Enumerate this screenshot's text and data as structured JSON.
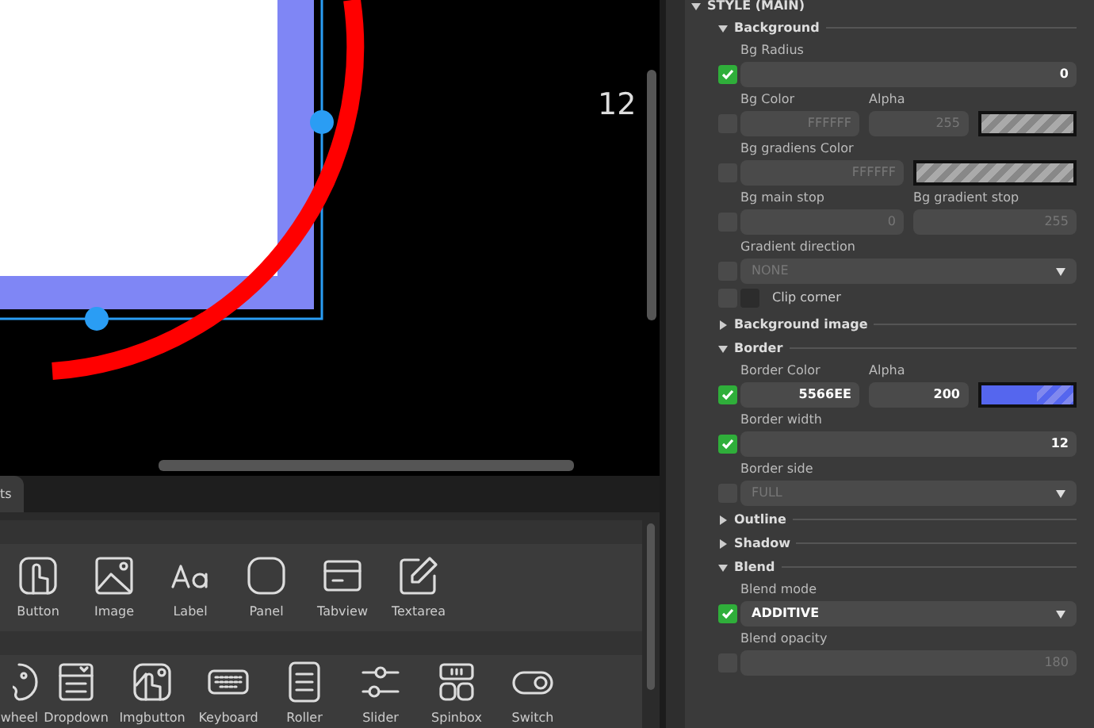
{
  "canvas": {
    "ruler_label": "12"
  },
  "widget_tabs": [
    {
      "label": "ts",
      "selected": true
    }
  ],
  "widget_rows": [
    {
      "items": [
        {
          "label": "Button",
          "kind": "button"
        },
        {
          "label": "Image",
          "kind": "image"
        },
        {
          "label": "Label",
          "kind": "label"
        },
        {
          "label": "Panel",
          "kind": "panel"
        },
        {
          "label": "Tabview",
          "kind": "tabview"
        },
        {
          "label": "Textarea",
          "kind": "textarea"
        }
      ]
    },
    {
      "items": [
        {
          "label": "wheel",
          "kind": "palette"
        },
        {
          "label": "Dropdown",
          "kind": "dropdown"
        },
        {
          "label": "Imgbutton",
          "kind": "imgbutton"
        },
        {
          "label": "Keyboard",
          "kind": "keyboard"
        },
        {
          "label": "Roller",
          "kind": "roller"
        },
        {
          "label": "Slider",
          "kind": "slider"
        },
        {
          "label": "Spinbox",
          "kind": "spinbox"
        },
        {
          "label": "Switch",
          "kind": "switch"
        }
      ]
    }
  ],
  "inspector": {
    "title": "STYLE (MAIN)",
    "expanded": true,
    "groups": [
      {
        "title": "Background",
        "expanded": true,
        "props": [
          {
            "checked": true,
            "fields": [
              {
                "kind": "number",
                "label": "Bg Radius",
                "value": "0"
              }
            ]
          },
          {
            "checked": false,
            "fields": [
              {
                "kind": "number",
                "label": "Bg Color",
                "value": "FFFFFF"
              },
              {
                "kind": "number",
                "label": "Alpha",
                "value": "255"
              },
              {
                "kind": "swatch"
              }
            ]
          },
          {
            "checked": false,
            "fields": [
              {
                "kind": "number",
                "label": "Bg gradiens Color",
                "value": "FFFFFF"
              },
              {
                "kind": "swatch"
              }
            ]
          },
          {
            "checked": false,
            "fields": [
              {
                "kind": "number",
                "label": "Bg main stop",
                "value": "0"
              },
              {
                "kind": "number",
                "label": "Bg gradient stop",
                "value": "255"
              }
            ]
          },
          {
            "checked": false,
            "fields": [
              {
                "kind": "select",
                "label": "Gradient direction",
                "value": "NONE"
              }
            ]
          },
          {
            "checked": false,
            "fields": [
              {
                "kind": "check",
                "checked": false,
                "text": "Clip corner"
              }
            ]
          }
        ]
      },
      {
        "title": "Background image",
        "expanded": false
      },
      {
        "title": "Border",
        "expanded": true,
        "props": [
          {
            "checked": true,
            "fields": [
              {
                "kind": "number",
                "label": "Border Color",
                "value": "5566EE"
              },
              {
                "kind": "number",
                "label": "Alpha",
                "value": "200"
              },
              {
                "kind": "swatch",
                "color": "#5566ee"
              }
            ]
          },
          {
            "checked": true,
            "fields": [
              {
                "kind": "number",
                "label": "Border width",
                "value": "12"
              }
            ]
          },
          {
            "checked": false,
            "fields": [
              {
                "kind": "select",
                "label": "Border side",
                "value": "FULL"
              }
            ]
          }
        ]
      },
      {
        "title": "Outline",
        "expanded": false
      },
      {
        "title": "Shadow",
        "expanded": false
      },
      {
        "title": "Blend",
        "expanded": true,
        "props": [
          {
            "checked": true,
            "fields": [
              {
                "kind": "select",
                "label": "Blend mode",
                "value": "ADDITIVE"
              }
            ]
          },
          {
            "checked": false,
            "fields": [
              {
                "kind": "number",
                "label": "Blend opacity",
                "value": "180"
              }
            ]
          }
        ]
      }
    ]
  }
}
